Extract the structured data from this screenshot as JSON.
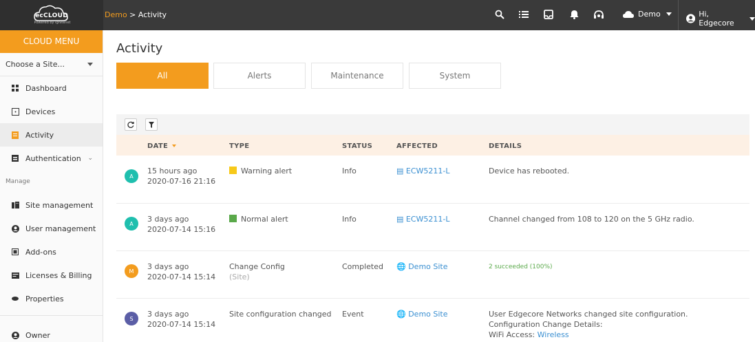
{
  "app": {
    "logo_text": "ecCLOUD",
    "logo_sub": "Powered by Ignitenet",
    "breadcrumb_site": "Demo",
    "breadcrumb_sep": " > ",
    "breadcrumb_page": "Activity"
  },
  "topbar": {
    "site_name": "Demo",
    "user_greeting": "Hi, Edgecore"
  },
  "sidebar": {
    "menu_title": "CLOUD MENU",
    "choose_site": "Choose a Site...",
    "items": [
      {
        "label": "Dashboard",
        "icon": "dashboard-icon"
      },
      {
        "label": "Devices",
        "icon": "device-icon"
      },
      {
        "label": "Activity",
        "icon": "activity-icon"
      },
      {
        "label": "Authentication",
        "icon": "authentication-icon"
      }
    ],
    "section_manage": "Manage",
    "manage_items": [
      {
        "label": "Site management",
        "icon": "site-icon"
      },
      {
        "label": "User management",
        "icon": "user-icon"
      },
      {
        "label": "Add-ons",
        "icon": "addons-icon"
      },
      {
        "label": "Licenses & Billing",
        "icon": "billing-icon"
      },
      {
        "label": "Properties",
        "icon": "properties-icon"
      }
    ],
    "owner": "Owner"
  },
  "page": {
    "title": "Activity",
    "tabs": [
      "All",
      "Alerts",
      "Maintenance",
      "System"
    ]
  },
  "table": {
    "headers": [
      "DATE",
      "TYPE",
      "STATUS",
      "AFFECTED",
      "DETAILS"
    ],
    "rows": [
      {
        "avatar": "A",
        "avatar_color": "#1fbfae",
        "date_rel": "15 hours ago",
        "date_abs": "2020-07-16 21:16",
        "type": "Warning alert",
        "type_color": "#f7c91a",
        "status": "Info",
        "affected": "ECW5211-L",
        "details": "Device has rebooted."
      },
      {
        "avatar": "A",
        "avatar_color": "#1fbfae",
        "date_rel": "3 days ago",
        "date_abs": "2020-07-14 15:16",
        "type": "Normal alert",
        "type_color": "#5aa94a",
        "status": "Info",
        "affected": "ECW5211-L",
        "details": "Channel changed from 108 to 120 on the 5 GHz radio."
      },
      {
        "avatar": "M",
        "avatar_color": "#f39c1e",
        "date_rel": "3 days ago",
        "date_abs": "2020-07-14 15:14",
        "type": "Change Config",
        "type_sub": "(Site)",
        "status": "Completed",
        "affected": "Demo Site",
        "details": "2 succeeded (100%)"
      },
      {
        "avatar": "S",
        "avatar_color": "#5b5ea6",
        "date_rel": "3 days ago",
        "date_abs": "2020-07-14 15:14",
        "type": "Site configuration changed",
        "status": "Event",
        "affected": "Demo Site",
        "details": "User Edgecore Networks changed site configuration.",
        "details_line2": "Configuration Change Details:",
        "details_line3_label": "WiFi Access: ",
        "details_line3_link": "Wireless"
      }
    ]
  },
  "colors": {
    "accent": "#f39c1e",
    "topbar": "#3a3a3a",
    "link": "#3a8fd1"
  }
}
